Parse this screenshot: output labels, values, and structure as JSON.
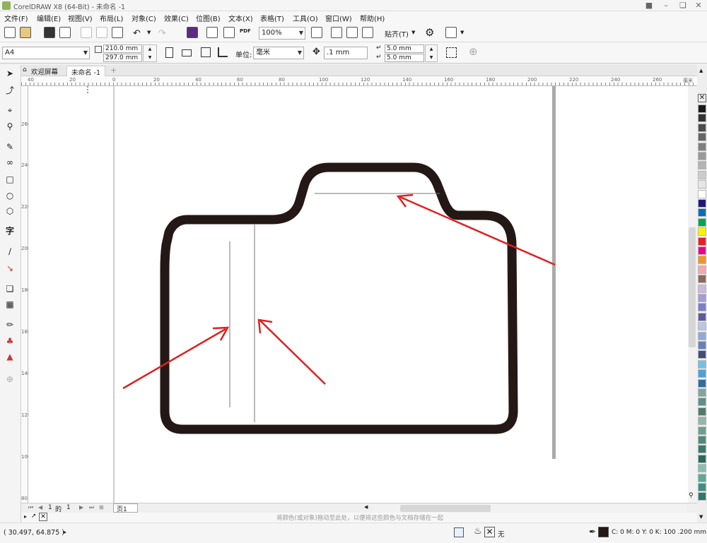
{
  "window": {
    "title": "CorelDRAW X8 (64-Bit) - 未命名 -1"
  },
  "menu": [
    "文件(F)",
    "编辑(E)",
    "视图(V)",
    "布局(L)",
    "对象(C)",
    "效果(C)",
    "位图(B)",
    "文本(X)",
    "表格(T)",
    "工具(O)",
    "窗口(W)",
    "帮助(H)"
  ],
  "toolbar": {
    "zoom": "100%",
    "snap_label": "贴齐(T)",
    "pdf_label": "PDF"
  },
  "propbar": {
    "page_size": "A4",
    "width": "210.0 mm",
    "height": "297.0 mm",
    "unit_label": "单位:",
    "unit": "毫米",
    "nudge": ".1 mm",
    "dup_x": "5.0 mm",
    "dup_y": "5.0 mm"
  },
  "tabs": {
    "welcome": "欢迎屏幕",
    "document": "未命名 -1"
  },
  "hruler_labels": [
    "40",
    "20",
    "0",
    "20",
    "40",
    "60",
    "80",
    "100",
    "120",
    "140",
    "160",
    "180",
    "200",
    "220",
    "240",
    "260"
  ],
  "hruler_unit": "毫米",
  "vruler_labels": [
    "260",
    "240",
    "220",
    "200",
    "180",
    "160",
    "140",
    "120",
    "100",
    "80"
  ],
  "pagenav": {
    "current": "1",
    "of": "的",
    "total": "1",
    "page_tab": "页1"
  },
  "hint": "将颜色(或对象)拖动至此处，以便将这些颜色与文档存储在一起",
  "status": {
    "coords": "( 30.497, 64.875 )",
    "fill": "无",
    "outline": "C: 0 M: 0 Y: 0 K: 100  .200 mm"
  },
  "palette": [
    "#1a1a1a",
    "#333333",
    "#4d4d4d",
    "#666666",
    "#808080",
    "#999999",
    "#b3b3b3",
    "#cccccc",
    "#e6e6e6",
    "#ffffff",
    "#1f1a7a",
    "#0070c0",
    "#00a651",
    "#fff200",
    "#ed1c24",
    "#ec008c",
    "#f7941d",
    "#f4a9a8",
    "#8c6a5a",
    "#c9b8e0",
    "#a59bd6",
    "#7b7fc4",
    "#5f5b9e",
    "#b7c7e4",
    "#8eaadb",
    "#6a7fb5",
    "#3f4d7a",
    "#6fc1e6",
    "#4aa3d8",
    "#2e6e9e",
    "#7ca6a0",
    "#5f8f88",
    "#4f7a6a",
    "#8fb8a8",
    "#6aa090",
    "#4d8c7a",
    "#3a7a6a",
    "#2a6a5a",
    "#86c0b0",
    "#5ea898",
    "#3e9080",
    "#2e7a6a"
  ]
}
